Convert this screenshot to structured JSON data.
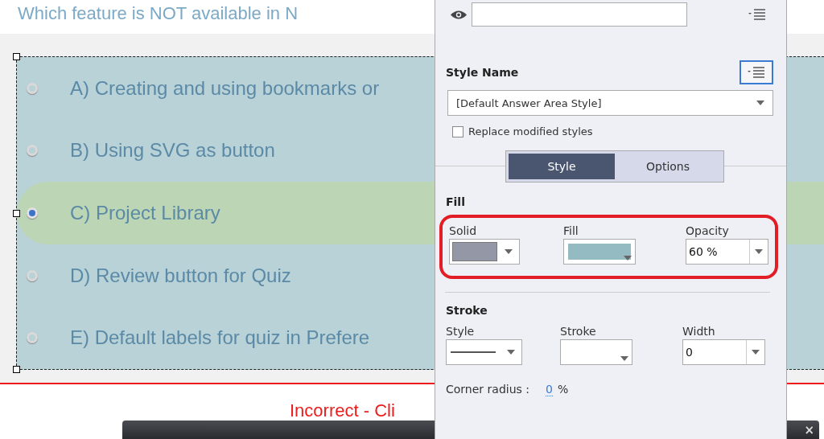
{
  "question_title": "Which feature is NOT available in N",
  "answer_options": [
    {
      "label": "A) Creating and using bookmarks or",
      "selected": false
    },
    {
      "label": "B) Using SVG as button",
      "selected": false
    },
    {
      "label": "C) Project Library",
      "selected": true
    },
    {
      "label": "D) Review button for Quiz",
      "selected": false
    },
    {
      "label": "E) Default labels for quiz in Prefere",
      "selected": false
    }
  ],
  "feedback": "Incorrect - Cli",
  "bottom_bar": {
    "close_glyph": "×"
  },
  "properties_panel": {
    "name_field": {
      "visible": true
    },
    "style_name": {
      "title": "Style Name",
      "value": "[Default Answer Area Style]",
      "replace_modified_styles": {
        "label": "Replace modified styles",
        "checked": false
      }
    },
    "tabs": [
      {
        "label": "Style",
        "selected": true
      },
      {
        "label": "Options",
        "selected": false
      }
    ],
    "fill": {
      "title": "Fill",
      "highlighted": true,
      "fields": [
        {
          "label": "Solid",
          "kind": "swatch",
          "color": "#9497a6"
        },
        {
          "label": "Fill",
          "kind": "picker",
          "color": "#93bbc1"
        },
        {
          "label": "Opacity",
          "kind": "number",
          "value": "60 %"
        }
      ]
    },
    "stroke": {
      "title": "Stroke",
      "fields": [
        {
          "label": "Style",
          "kind": "line"
        },
        {
          "label": "Stroke",
          "kind": "picker"
        },
        {
          "label": "Width",
          "kind": "number",
          "value": "0"
        }
      ]
    },
    "corner_radius": {
      "label": "Corner radius :",
      "value": "0",
      "unit": "%"
    }
  }
}
